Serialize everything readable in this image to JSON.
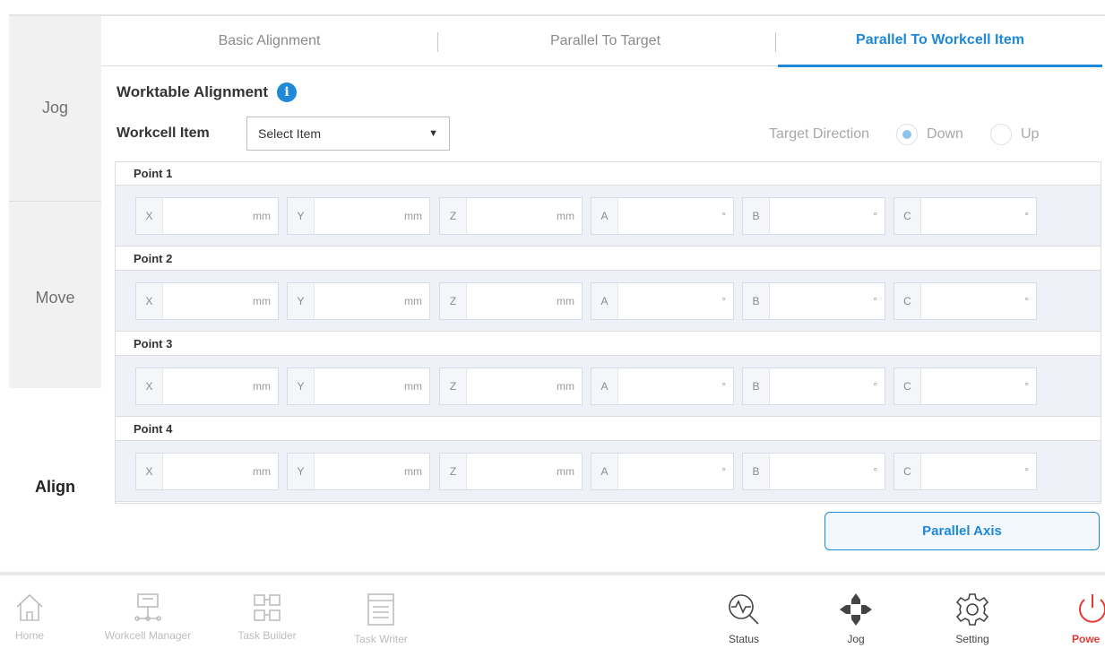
{
  "sidenav": {
    "items": [
      {
        "label": "Jog"
      },
      {
        "label": "Move"
      },
      {
        "label": "Align"
      }
    ]
  },
  "tabs": [
    {
      "label": "Basic Alignment"
    },
    {
      "label": "Parallel To Target"
    },
    {
      "label": "Parallel To Workcell Item"
    }
  ],
  "main": {
    "heading": "Worktable Alignment",
    "info_icon_glyph": "i",
    "workcell_label": "Workcell Item",
    "select_placeholder": "Select Item",
    "target_direction_label": "Target Direction",
    "radio_down": "Down",
    "radio_up": "Up",
    "selected_direction": "Down"
  },
  "points": [
    {
      "label": "Point 1"
    },
    {
      "label": "Point 2"
    },
    {
      "label": "Point 3"
    },
    {
      "label": "Point 4"
    }
  ],
  "fields": [
    {
      "axis": "X",
      "unit": "mm"
    },
    {
      "axis": "Y",
      "unit": "mm"
    },
    {
      "axis": "Z",
      "unit": "mm"
    },
    {
      "axis": "A",
      "unit": "°"
    },
    {
      "axis": "B",
      "unit": "°"
    },
    {
      "axis": "C",
      "unit": "°"
    }
  ],
  "parallel_button": "Parallel Axis",
  "bottombar": {
    "items": [
      {
        "label": "Home",
        "icon": "home-icon"
      },
      {
        "label": "Workcell Manager",
        "icon": "workcell-manager-icon"
      },
      {
        "label": "Task Builder",
        "icon": "task-builder-icon"
      },
      {
        "label": "Task Writer",
        "icon": "task-writer-icon"
      },
      {
        "label": "Status",
        "icon": "status-icon"
      },
      {
        "label": "Jog",
        "icon": "jog-icon"
      },
      {
        "label": "Setting",
        "icon": "gear-icon"
      },
      {
        "label": "Powe",
        "icon": "power-icon"
      }
    ]
  },
  "colors": {
    "accent": "#1e88d9",
    "power": "#e53935"
  }
}
